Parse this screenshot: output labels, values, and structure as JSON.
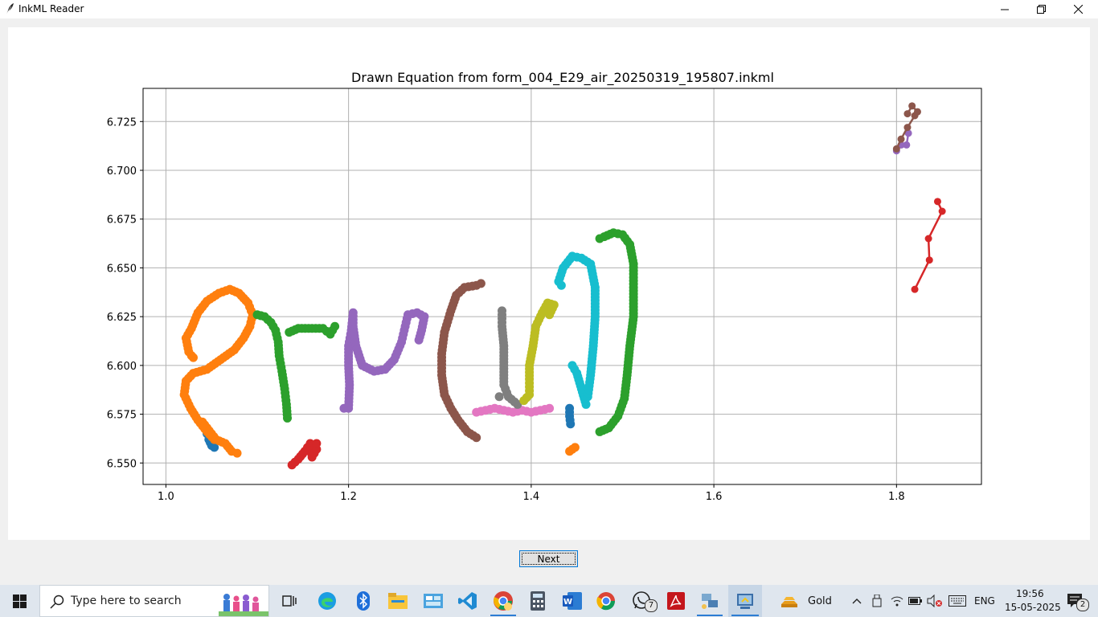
{
  "window": {
    "title": "InkML Reader",
    "controls": [
      "minimize-icon",
      "maximize-icon",
      "close-icon"
    ]
  },
  "chart_data": {
    "type": "scatter",
    "title": "Drawn Equation from form_004_E29_air_20250319_195807.inkml",
    "xlabel": "",
    "ylabel": "",
    "xlim": [
      0.975,
      1.893
    ],
    "ylim": [
      6.742,
      6.539
    ],
    "y_inverted": true,
    "grid": true,
    "xticks": [
      "1.0",
      "1.2",
      "1.4",
      "1.6",
      "1.8"
    ],
    "yticks": [
      "6.550",
      "6.575",
      "6.600",
      "6.625",
      "6.650",
      "6.675",
      "6.700",
      "6.725"
    ],
    "series": [
      {
        "color": "#1f77b4",
        "style": "dots",
        "points": [
          [
            1.045,
            6.565
          ],
          [
            1.047,
            6.562
          ],
          [
            1.05,
            6.559
          ],
          [
            1.053,
            6.558
          ]
        ]
      },
      {
        "color": "#ff7f0e",
        "style": "dots",
        "points": [
          [
            1.053,
            6.562
          ],
          [
            1.045,
            6.566
          ],
          [
            1.035,
            6.572
          ],
          [
            1.027,
            6.578
          ],
          [
            1.02,
            6.585
          ],
          [
            1.022,
            6.592
          ],
          [
            1.03,
            6.596
          ],
          [
            1.045,
            6.598
          ],
          [
            1.06,
            6.603
          ],
          [
            1.075,
            6.608
          ],
          [
            1.085,
            6.614
          ],
          [
            1.092,
            6.62
          ],
          [
            1.095,
            6.626
          ],
          [
            1.09,
            6.632
          ],
          [
            1.08,
            6.637
          ],
          [
            1.07,
            6.639
          ],
          [
            1.058,
            6.637
          ],
          [
            1.045,
            6.633
          ],
          [
            1.035,
            6.627
          ],
          [
            1.028,
            6.619
          ],
          [
            1.022,
            6.614
          ],
          [
            1.025,
            6.607
          ],
          [
            1.028,
            6.605
          ],
          [
            1.03,
            6.604
          ],
          [
            1.04,
            6.571
          ],
          [
            1.055,
            6.562
          ],
          [
            1.065,
            6.56
          ],
          [
            1.072,
            6.556
          ],
          [
            1.078,
            6.555
          ]
        ]
      },
      {
        "color": "#2ca02c",
        "style": "dots",
        "points": [
          [
            1.133,
            6.573
          ],
          [
            1.132,
            6.58
          ],
          [
            1.13,
            6.588
          ],
          [
            1.127,
            6.597
          ],
          [
            1.124,
            6.605
          ],
          [
            1.123,
            6.612
          ],
          [
            1.12,
            6.618
          ],
          [
            1.115,
            6.622
          ],
          [
            1.108,
            6.625
          ],
          [
            1.1,
            6.626
          ],
          [
            1.135,
            6.617
          ],
          [
            1.145,
            6.619
          ],
          [
            1.16,
            6.619
          ],
          [
            1.172,
            6.619
          ],
          [
            1.18,
            6.616
          ],
          [
            1.185,
            6.62
          ]
        ]
      },
      {
        "color": "#d62728",
        "style": "dots",
        "points": [
          [
            1.138,
            6.549
          ],
          [
            1.145,
            6.552
          ],
          [
            1.152,
            6.556
          ],
          [
            1.158,
            6.56
          ],
          [
            1.16,
            6.553
          ],
          [
            1.165,
            6.557
          ],
          [
            1.165,
            6.56
          ]
        ]
      },
      {
        "color": "#9467bd",
        "style": "dots",
        "points": [
          [
            1.195,
            6.578
          ],
          [
            1.2,
            6.578
          ],
          [
            1.201,
            6.59
          ],
          [
            1.2,
            6.6
          ],
          [
            1.2,
            6.61
          ],
          [
            1.203,
            6.618
          ],
          [
            1.205,
            6.627
          ],
          [
            1.205,
            6.62
          ],
          [
            1.208,
            6.61
          ],
          [
            1.215,
            6.6
          ],
          [
            1.228,
            6.597
          ],
          [
            1.24,
            6.598
          ],
          [
            1.25,
            6.603
          ],
          [
            1.258,
            6.612
          ],
          [
            1.262,
            6.62
          ],
          [
            1.265,
            6.626
          ],
          [
            1.275,
            6.627
          ],
          [
            1.283,
            6.625
          ],
          [
            1.28,
            6.618
          ],
          [
            1.277,
            6.613
          ]
        ]
      },
      {
        "color": "#8c564b",
        "style": "dots",
        "points": [
          [
            1.34,
            6.563
          ],
          [
            1.33,
            6.566
          ],
          [
            1.32,
            6.572
          ],
          [
            1.312,
            6.578
          ],
          [
            1.305,
            6.585
          ],
          [
            1.302,
            6.595
          ],
          [
            1.302,
            6.606
          ],
          [
            1.305,
            6.617
          ],
          [
            1.312,
            6.628
          ],
          [
            1.318,
            6.636
          ],
          [
            1.327,
            6.64
          ],
          [
            1.34,
            6.641
          ],
          [
            1.345,
            6.642
          ]
        ]
      },
      {
        "color": "#e377c2",
        "style": "dots",
        "points": [
          [
            1.34,
            6.576
          ],
          [
            1.35,
            6.577
          ],
          [
            1.36,
            6.578
          ],
          [
            1.37,
            6.577
          ],
          [
            1.38,
            6.576
          ],
          [
            1.39,
            6.577
          ],
          [
            1.4,
            6.576
          ],
          [
            1.41,
            6.577
          ],
          [
            1.42,
            6.578
          ]
        ]
      },
      {
        "color": "#7f7f7f",
        "style": "dots",
        "points": [
          [
            1.385,
            6.58
          ],
          [
            1.375,
            6.584
          ],
          [
            1.37,
            6.59
          ],
          [
            1.37,
            6.6
          ],
          [
            1.37,
            6.61
          ],
          [
            1.368,
            6.62
          ],
          [
            1.368,
            6.628
          ],
          [
            1.365,
            6.584
          ]
        ]
      },
      {
        "color": "#bcbd22",
        "style": "dots",
        "points": [
          [
            1.392,
            6.582
          ],
          [
            1.398,
            6.585
          ],
          [
            1.398,
            6.593
          ],
          [
            1.398,
            6.6
          ],
          [
            1.402,
            6.61
          ],
          [
            1.405,
            6.62
          ],
          [
            1.412,
            6.627
          ],
          [
            1.418,
            6.632
          ],
          [
            1.425,
            6.631
          ],
          [
            1.42,
            6.626
          ]
        ]
      },
      {
        "color": "#17becf",
        "style": "dots",
        "points": [
          [
            1.46,
            6.58
          ],
          [
            1.455,
            6.588
          ],
          [
            1.45,
            6.596
          ],
          [
            1.445,
            6.6
          ],
          [
            1.462,
            6.584
          ],
          [
            1.465,
            6.595
          ],
          [
            1.468,
            6.61
          ],
          [
            1.47,
            6.625
          ],
          [
            1.47,
            6.64
          ],
          [
            1.465,
            6.652
          ],
          [
            1.455,
            6.655
          ],
          [
            1.445,
            6.656
          ],
          [
            1.435,
            6.65
          ],
          [
            1.43,
            6.643
          ],
          [
            1.433,
            6.641
          ]
        ]
      },
      {
        "color": "#1f77b4",
        "style": "dots",
        "points": [
          [
            1.443,
            6.57
          ],
          [
            1.442,
            6.574
          ],
          [
            1.442,
            6.578
          ]
        ]
      },
      {
        "color": "#ff7f0e",
        "style": "dots",
        "points": [
          [
            1.442,
            6.556
          ],
          [
            1.448,
            6.558
          ]
        ]
      },
      {
        "color": "#2ca02c",
        "style": "dots",
        "points": [
          [
            1.475,
            6.566
          ],
          [
            1.485,
            6.568
          ],
          [
            1.495,
            6.574
          ],
          [
            1.502,
            6.583
          ],
          [
            1.505,
            6.595
          ],
          [
            1.508,
            6.61
          ],
          [
            1.512,
            6.625
          ],
          [
            1.512,
            6.64
          ],
          [
            1.512,
            6.652
          ],
          [
            1.508,
            6.662
          ],
          [
            1.5,
            6.667
          ],
          [
            1.49,
            6.668
          ],
          [
            1.48,
            6.666
          ],
          [
            1.475,
            6.665
          ]
        ]
      },
      {
        "color": "#d62728",
        "style": "line",
        "points": [
          [
            1.82,
            6.639
          ],
          [
            1.836,
            6.654
          ],
          [
            1.835,
            6.665
          ],
          [
            1.85,
            6.679
          ],
          [
            1.845,
            6.684
          ]
        ]
      },
      {
        "color": "#9467bd",
        "style": "line",
        "points": [
          [
            1.8,
            6.71
          ],
          [
            1.805,
            6.713
          ],
          [
            1.811,
            6.713
          ],
          [
            1.813,
            6.719
          ]
        ]
      },
      {
        "color": "#8c564b",
        "style": "line",
        "points": [
          [
            1.8,
            6.711
          ],
          [
            1.805,
            6.716
          ],
          [
            1.812,
            6.722
          ],
          [
            1.82,
            6.728
          ],
          [
            1.823,
            6.73
          ],
          [
            1.817,
            6.733
          ],
          [
            1.812,
            6.729
          ]
        ]
      }
    ]
  },
  "buttons": {
    "next_label": "Next"
  },
  "taskbar": {
    "search_placeholder": "Type here to search",
    "apps": [
      "windows-start-icon",
      "task-view-icon",
      "edge-icon",
      "bluetooth-icon",
      "file-explorer-icon",
      "control-panel-icon",
      "vscode-icon",
      "chrome-user-icon",
      "calculator-icon",
      "word-icon",
      "chrome-icon",
      "whatsapp-icon",
      "acrobat-icon",
      "network-app-icon",
      "python-icon"
    ],
    "whatsapp_badge": "7",
    "gold_label": "Gold",
    "language": "ENG",
    "time": "19:56",
    "date": "15-05-2025",
    "notifications": "2"
  }
}
